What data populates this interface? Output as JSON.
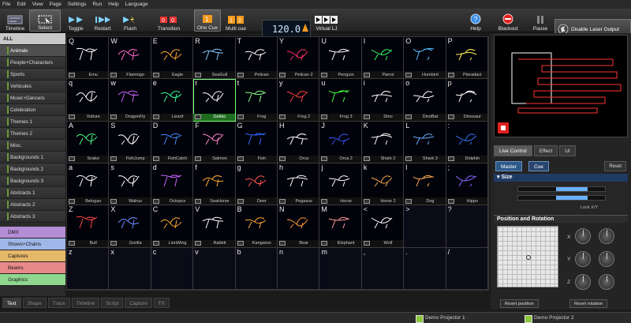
{
  "menu": [
    "File",
    "Edit",
    "View",
    "Page",
    "Settings",
    "Run",
    "Help",
    "Language"
  ],
  "toolbar": {
    "timeline": "Timeline",
    "select": "Select",
    "toggle": "Toggle",
    "restart": "Restart",
    "flash": "Flash",
    "transition": "Transition",
    "one_cue": "One Cue",
    "multi_cue": "Multi cue",
    "bpm": "120.0",
    "virtual_lj": "Virtual LJ",
    "help": "Help",
    "blackout": "Blackout",
    "pause": "Pause",
    "disable_laser": "Disable Laser Output"
  },
  "categories": [
    "ALL",
    "Animals",
    "People+Characters",
    "Sports",
    "Vehicules",
    "Music+Dancers",
    "Celebration",
    "Themes 1",
    "Themes 2",
    "Misc.",
    "Backgrounds 1",
    "Backgrounds 2",
    "Backgrounds 3",
    "Abstracts 1",
    "Abstracts 2",
    "Abstracts 3"
  ],
  "groups": [
    {
      "label": "DMX",
      "color": "#b58cd6"
    },
    {
      "label": "Shows+Chains",
      "color": "#9fb7e8"
    },
    {
      "label": "Captures",
      "color": "#e6b86a"
    },
    {
      "label": "Beams",
      "color": "#e88a8a"
    },
    {
      "label": "Graphics",
      "color": "#8fd68f"
    }
  ],
  "grid": [
    [
      {
        "l": "Q",
        "n": "Emu",
        "c": "#ffffff"
      },
      {
        "l": "W",
        "n": "Flamingo",
        "c": "#ff66cc"
      },
      {
        "l": "E",
        "n": "Eagle",
        "c": "#ffaa33"
      },
      {
        "l": "R",
        "n": "SeaGull",
        "c": "#88ccff"
      },
      {
        "l": "T",
        "n": "Pelican",
        "c": "#ffffff"
      },
      {
        "l": "Y",
        "n": "Pelican 2",
        "c": "#ff3366"
      },
      {
        "l": "U",
        "n": "Penguin",
        "c": "#ffffff"
      },
      {
        "l": "I",
        "n": "Parrot",
        "c": "#33ff66"
      },
      {
        "l": "O",
        "n": "Humbird",
        "c": "#55bbff"
      },
      {
        "l": "P",
        "n": "Pteradact",
        "c": "#ffee55"
      }
    ],
    [
      {
        "l": "q",
        "n": "Vulture",
        "c": "#ffffff"
      },
      {
        "l": "w",
        "n": "DragonFly",
        "c": "#cc66ff"
      },
      {
        "l": "e",
        "n": "Lizard",
        "c": "#33ff99"
      },
      {
        "l": "r",
        "n": "Gekko",
        "c": "#ffffff"
      },
      {
        "l": "t",
        "n": "Frog",
        "c": "#88ff88"
      },
      {
        "l": "y",
        "n": "Frog 2",
        "c": "#ff4444"
      },
      {
        "l": "u",
        "n": "Frog 3",
        "c": "#44ff44"
      },
      {
        "l": "i",
        "n": "Dino",
        "c": "#ffffff"
      },
      {
        "l": "o",
        "n": "DinoBat",
        "c": "#ffffff"
      },
      {
        "l": "p",
        "n": "Dinosaur",
        "c": "#ffffff"
      }
    ],
    [
      {
        "l": "A",
        "n": "Snake",
        "c": "#44ff88"
      },
      {
        "l": "S",
        "n": "FishJump",
        "c": "#ffffff"
      },
      {
        "l": "D",
        "n": "FishCatch",
        "c": "#4488ff"
      },
      {
        "l": "F",
        "n": "Salmon",
        "c": "#ff88cc"
      },
      {
        "l": "G",
        "n": "Fish",
        "c": "#3366ff"
      },
      {
        "l": "H",
        "n": "Orca",
        "c": "#ffffff"
      },
      {
        "l": "J",
        "n": "Orca 2",
        "c": "#3355ff"
      },
      {
        "l": "K",
        "n": "Shark 2",
        "c": "#ffffff"
      },
      {
        "l": "L",
        "n": "Shark 3",
        "c": "#66aaff"
      },
      {
        "l": ":",
        "n": "Dolphin",
        "c": "#3377ff"
      }
    ],
    [
      {
        "l": "a",
        "n": "Belugas",
        "c": "#ffffff"
      },
      {
        "l": "s",
        "n": "Walrus",
        "c": "#ffffff"
      },
      {
        "l": "d",
        "n": "Octopus",
        "c": "#cc66ff"
      },
      {
        "l": "f",
        "n": "SeaHorse",
        "c": "#ffaa33"
      },
      {
        "l": "g",
        "n": "Deer",
        "c": "#ff5555"
      },
      {
        "l": "h",
        "n": "Pegasus",
        "c": "#ffffff"
      },
      {
        "l": "j",
        "n": "Horse",
        "c": "#ffffff"
      },
      {
        "l": "k",
        "n": "Horse 2",
        "c": "#ffaa55"
      },
      {
        "l": "l",
        "n": "Dog",
        "c": "#ffaa55"
      },
      {
        "l": ";",
        "n": "Hippo",
        "c": "#8866ff"
      }
    ],
    [
      {
        "l": "Z",
        "n": "Bull",
        "c": "#ff4444"
      },
      {
        "l": "X",
        "n": "Gorilla",
        "c": "#6688ff"
      },
      {
        "l": "C",
        "n": "LionWing",
        "c": "#ffaa33"
      },
      {
        "l": "V",
        "n": "Rabbit",
        "c": "#ffffff"
      },
      {
        "l": "B",
        "n": "Kangaroo",
        "c": "#ffaa33"
      },
      {
        "l": "N",
        "n": "Bear",
        "c": "#ff9933"
      },
      {
        "l": "M",
        "n": "Elephant",
        "c": "#ff9999"
      },
      {
        "l": "<",
        "n": "Wolf",
        "c": "#ffffff"
      },
      {
        "l": ">",
        "n": "",
        "c": ""
      },
      {
        "l": "?",
        "n": "",
        "c": ""
      }
    ],
    [
      {
        "l": "z",
        "n": "",
        "c": ""
      },
      {
        "l": "x",
        "n": "",
        "c": ""
      },
      {
        "l": "c",
        "n": "",
        "c": ""
      },
      {
        "l": "v",
        "n": "",
        "c": ""
      },
      {
        "l": "b",
        "n": "",
        "c": ""
      },
      {
        "l": "n",
        "n": "",
        "c": ""
      },
      {
        "l": "m",
        "n": "",
        "c": ""
      },
      {
        "l": ",",
        "n": "",
        "c": ""
      },
      {
        "l": ".",
        "n": "",
        "c": ""
      },
      {
        "l": "/",
        "n": "",
        "c": ""
      }
    ]
  ],
  "right": {
    "tabs": [
      "Live Control",
      "Effect",
      "UI"
    ],
    "master": "Master",
    "cue": "Cue",
    "reset": "Reset",
    "size_title": "Size",
    "lock_label": "Lock X/Y",
    "pos_title": "Position and Rotation",
    "axes": [
      "X",
      "Y",
      "Z"
    ],
    "reset_position": "Reset position",
    "reset_rotation": "Reset rotation"
  },
  "bottom_tabs": [
    "Text",
    "Shape",
    "Trace",
    "Timeline",
    "Script",
    "Capture",
    "FX"
  ],
  "projectors": [
    "Demo Projector 1",
    "Demo Projector 2"
  ],
  "colors": {
    "accent": "#2e5a8a",
    "selection": "#7fff7f",
    "preview_red": "#ff3333"
  }
}
